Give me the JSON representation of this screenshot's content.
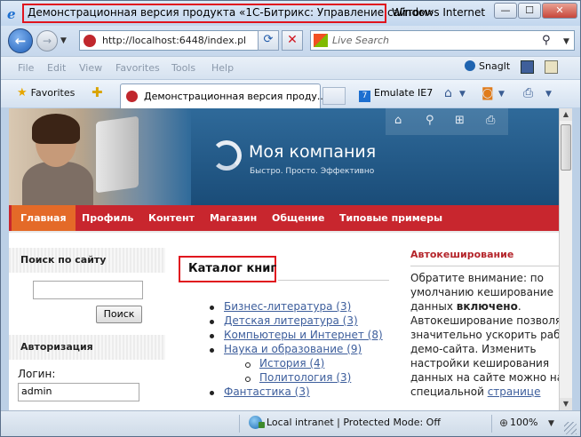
{
  "window": {
    "title": "Демонстрационная версия продукта «1С-Битрикс: Управление сайтом»",
    "title_suffix": "Windows Internet",
    "min_glyph": "—",
    "max_glyph": "☐",
    "close_glyph": "✕"
  },
  "address": {
    "url": "http://localhost:6448/index.pl",
    "search_placeholder": "Live Search"
  },
  "menu": {
    "items": [
      "File",
      "Edit",
      "View",
      "Favorites",
      "Tools",
      "Help"
    ],
    "snagit": "SnagIt"
  },
  "favbar": {
    "favorites": "Favorites",
    "tab_label": "Демонстрационная версия проду...",
    "emulate": "Emulate IE7"
  },
  "site": {
    "company_name": "Моя компания",
    "tagline": "Быстро. Просто. Эффективно",
    "nav": [
      "Главная",
      "Профиль",
      "Контент",
      "Магазин",
      "Общение",
      "Типовые примеры"
    ],
    "search_heading": "Поиск по сайту",
    "search_button": "Поиск",
    "auth_heading": "Авторизация",
    "login_label": "Логин:",
    "login_value": "admin",
    "catalog_title": "Каталог книг",
    "catalog_items": [
      {
        "label": "Бизнес-литература (3)",
        "level": 1
      },
      {
        "label": "Детская литература (3)",
        "level": 1
      },
      {
        "label": "Компьютеры и Интернет (8)",
        "level": 1
      },
      {
        "label": "Наука и образование (9)",
        "level": 1
      },
      {
        "label": "История (4)",
        "level": 2
      },
      {
        "label": "Политология (3)",
        "level": 2
      },
      {
        "label": "Фантастика (3)",
        "level": 1
      }
    ],
    "cache_heading": "Автокеширование",
    "cache_lines": [
      "Обратите внимание: по",
      "умолчанию кеширование",
      "данных ",
      "Автокеширование позволяет",
      "значительно ускорить работу",
      "демо-сайта. Изменить",
      "настройки кеширования",
      "данных на сайте можно на",
      "специальной "
    ],
    "cache_bold": "включено",
    "cache_link": "странице"
  },
  "status": {
    "text": "Local intranet | Protected Mode: Off",
    "zoom": "100%"
  },
  "colors": {
    "nav_red": "#c8262e",
    "nav_active": "#e46a28",
    "highlight": "#e0141e",
    "link": "#3d5e9c"
  },
  "icons": {
    "back": "back-arrow-icon",
    "forward": "forward-arrow-icon",
    "refresh": "refresh-icon",
    "stop": "stop-icon",
    "search": "search-icon",
    "home": "home-icon",
    "rss": "rss-icon",
    "print": "print-icon",
    "globe": "globe-icon",
    "zoom": "zoom-icon"
  }
}
